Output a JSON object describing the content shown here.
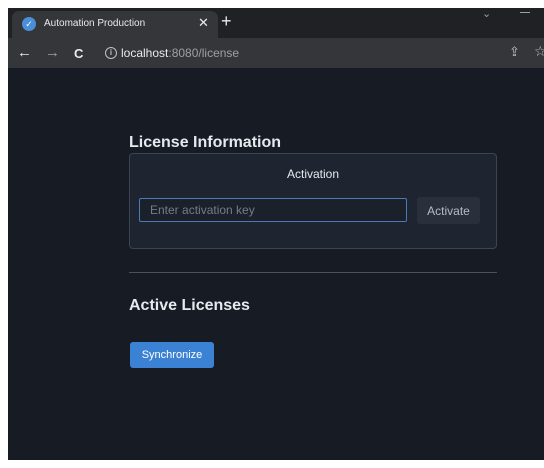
{
  "browser": {
    "tab": {
      "title": "Automation Production",
      "favicon_glyph": "✓",
      "close_glyph": "✕"
    },
    "new_tab_glyph": "+",
    "tabstrip_chevron_glyph": "⌄",
    "nav": {
      "back_glyph": "←",
      "forward_glyph": "→",
      "reload_glyph": "C"
    },
    "info_glyph": "i",
    "address": {
      "host": "localhost",
      "path": ":8080/license"
    },
    "share_glyph": "⇪",
    "bookmark_glyph": "☆"
  },
  "license_section": {
    "title": "License Information",
    "activation_panel": {
      "header": "Activation",
      "key_input_placeholder": "Enter activation key",
      "key_input_value": "",
      "activate_label": "Activate"
    }
  },
  "active_section": {
    "title": "Active Licenses",
    "sync_label": "Synchronize"
  },
  "colors": {
    "page_background": "#161b24",
    "panel_background": "#1f2530",
    "accent_button": "#3b82d4",
    "input_focus_border": "#4a78b8"
  },
  "icons": [
    "favicon-icon",
    "close-icon",
    "new-tab-icon",
    "chevron-down-icon",
    "back-arrow-icon",
    "forward-arrow-icon",
    "reload-icon",
    "info-icon",
    "share-icon",
    "bookmark-star-icon"
  ]
}
